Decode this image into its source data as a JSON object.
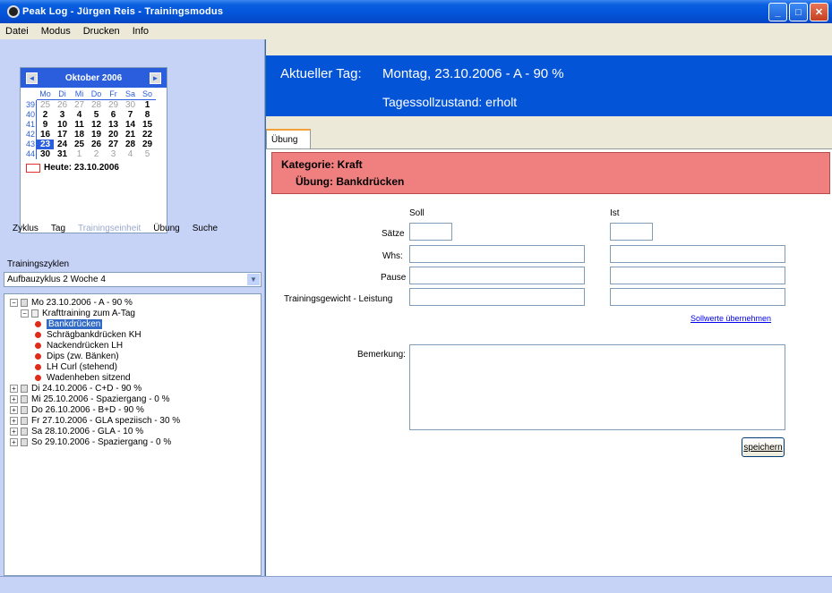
{
  "titlebar": {
    "title": "Peak Log - Jürgen Reis - Trainingsmodus"
  },
  "menu": {
    "items": [
      "Datei",
      "Modus",
      "Drucken",
      "Info"
    ]
  },
  "calendar": {
    "month_label": "Oktober 2006",
    "prev_icon": "◄",
    "next_icon": "►",
    "weekdays": [
      "Mo",
      "Di",
      "Mi",
      "Do",
      "Fr",
      "Sa",
      "So"
    ],
    "weeks": [
      {
        "wk": "39",
        "days": [
          {
            "d": "25",
            "dim": true
          },
          {
            "d": "26",
            "dim": true
          },
          {
            "d": "27",
            "dim": true
          },
          {
            "d": "28",
            "dim": true
          },
          {
            "d": "29",
            "dim": true
          },
          {
            "d": "30",
            "dim": true
          },
          {
            "d": "1",
            "dim": false
          }
        ]
      },
      {
        "wk": "40",
        "days": [
          {
            "d": "2"
          },
          {
            "d": "3"
          },
          {
            "d": "4"
          },
          {
            "d": "5"
          },
          {
            "d": "6"
          },
          {
            "d": "7"
          },
          {
            "d": "8"
          }
        ]
      },
      {
        "wk": "41",
        "days": [
          {
            "d": "9"
          },
          {
            "d": "10"
          },
          {
            "d": "11"
          },
          {
            "d": "12"
          },
          {
            "d": "13"
          },
          {
            "d": "14"
          },
          {
            "d": "15"
          }
        ]
      },
      {
        "wk": "42",
        "days": [
          {
            "d": "16"
          },
          {
            "d": "17"
          },
          {
            "d": "18"
          },
          {
            "d": "19"
          },
          {
            "d": "20"
          },
          {
            "d": "21"
          },
          {
            "d": "22"
          }
        ]
      },
      {
        "wk": "43",
        "days": [
          {
            "d": "23",
            "sel": true
          },
          {
            "d": "24"
          },
          {
            "d": "25"
          },
          {
            "d": "26"
          },
          {
            "d": "27"
          },
          {
            "d": "28"
          },
          {
            "d": "29"
          }
        ]
      },
      {
        "wk": "44",
        "days": [
          {
            "d": "30"
          },
          {
            "d": "31"
          },
          {
            "d": "1",
            "dim": true
          },
          {
            "d": "2",
            "dim": true
          },
          {
            "d": "3",
            "dim": true
          },
          {
            "d": "4",
            "dim": true
          },
          {
            "d": "5",
            "dim": true
          }
        ]
      }
    ],
    "today_label": "Heute: 23.10.2006"
  },
  "nav": {
    "items": [
      {
        "label": "Zyklus",
        "disabled": false
      },
      {
        "label": "Tag",
        "disabled": false
      },
      {
        "label": "Trainingseinheit",
        "disabled": true
      },
      {
        "label": "Übung",
        "disabled": false
      },
      {
        "label": "Suche",
        "disabled": false
      }
    ]
  },
  "cycles": {
    "label": "Trainingszyklen",
    "selected": "Aufbauzyklus 2 Woche 4",
    "arrow_icon": "▼"
  },
  "tree": [
    {
      "level": 0,
      "exp": "−",
      "text": "Mo 23.10.2006 - A - 90 %"
    },
    {
      "level": 1,
      "exp": "−",
      "doc": true,
      "text": "Krafttraining zum A-Tag"
    },
    {
      "level": 2,
      "dot": true,
      "text": "Bankdrücken",
      "highlight": true
    },
    {
      "level": 2,
      "dot": true,
      "text": "Schrägbankdrücken KH"
    },
    {
      "level": 2,
      "dot": true,
      "text": "Nackendrücken LH"
    },
    {
      "level": 2,
      "dot": true,
      "text": "Dips (zw. Bänken)"
    },
    {
      "level": 2,
      "dot": true,
      "text": "LH Curl (stehend)"
    },
    {
      "level": 2,
      "dot": true,
      "text": "Wadenheben sitzend"
    },
    {
      "level": 0,
      "exp": "+",
      "text": "Di 24.10.2006 - C+D - 90 %"
    },
    {
      "level": 0,
      "exp": "+",
      "text": "Mi 25.10.2006 - Spaziergang - 0 %"
    },
    {
      "level": 0,
      "exp": "+",
      "text": "Do 26.10.2006 - B+D - 90 %"
    },
    {
      "level": 0,
      "exp": "+",
      "text": "Fr 27.10.2006 - GLA speziisch - 30 %"
    },
    {
      "level": 0,
      "exp": "+",
      "text": "Sa 28.10.2006 - GLA - 10 %"
    },
    {
      "level": 0,
      "exp": "+",
      "text": "So 29.10.2006 - Spaziergang - 0 %"
    }
  ],
  "banner": {
    "label": "Aktueller Tag:",
    "day": "Montag, 23.10.2006 - A - 90 %",
    "status": "Tagessollzustand: erholt"
  },
  "tab": {
    "label": "Übung"
  },
  "category": {
    "line1": "Kategorie: Kraft",
    "line2": "Übung: Bankdrücken"
  },
  "form": {
    "soll_header": "Soll",
    "ist_header": "Ist",
    "fields": [
      "Sätze",
      "Whs:",
      "Pause",
      "Trainingsgewicht - Leistung"
    ],
    "take_over_link": "Sollwerte übernehmen",
    "remark_label": "Bemerkung:",
    "save_label": "speichern"
  },
  "colors": {
    "titlebar": "#0454d8",
    "banner": "#0454d8",
    "category_bar": "#f07f7f",
    "highlight": "#316ac5",
    "bullet": "#e02a1a"
  }
}
